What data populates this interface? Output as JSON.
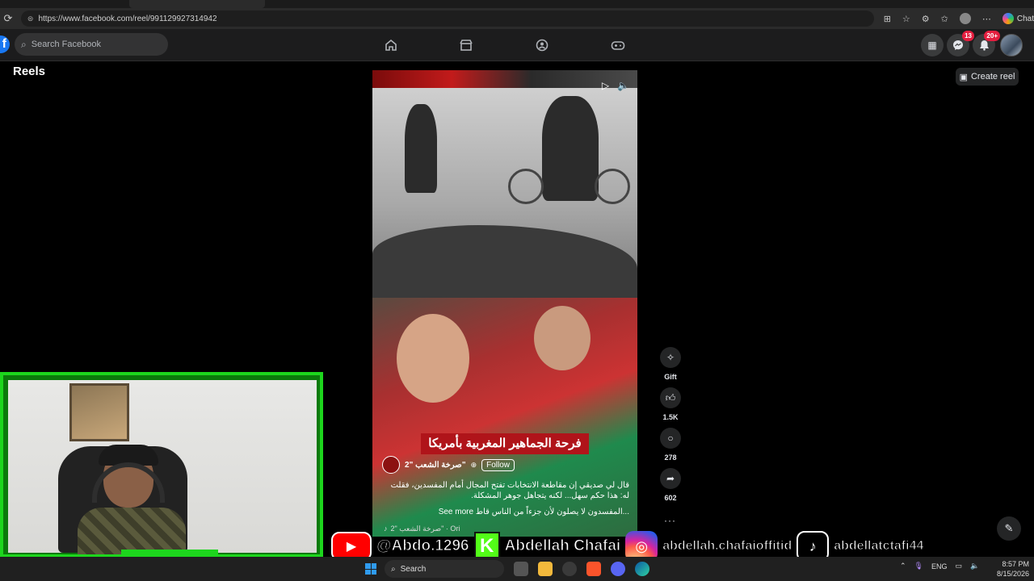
{
  "browser": {
    "url": "https://www.facebook.com/reel/991129927314942",
    "chat_label": "Chat"
  },
  "header": {
    "search_placeholder": "Search Facebook",
    "messenger_badge": "13",
    "notifications_badge": "20+"
  },
  "page": {
    "title": "Reels",
    "create_reel_label": "Create reel"
  },
  "reel": {
    "headline": "فرحة الجماهير المغربية بأمريكا",
    "author_name": "صرخة الشعب \"2\"",
    "follow_label": "Follow",
    "caption_line1": "قال لي صديقي إن مقاطعة الانتخابات تفتح المجال أمام المفسدين، فقلت له: هذا حكم سهل... لكنه يتجاهل جوهر المشكلة.",
    "caption_line2": "المفسدون لا يصلون لأن جزءاً من الناس قاط...",
    "see_more_label": "See more",
    "audio_label": "صرخة الشعب \"2\" · Ori"
  },
  "actions": {
    "gift_label": "Gift",
    "likes": "1.5K",
    "comments": "278",
    "shares": "602"
  },
  "banner": {
    "youtube_handle": "@Abdo.1296",
    "kick_handle": "Abdellah Chafai",
    "instagram_handle": "abdellah.chafaioffitid",
    "tiktok_handle": "abdellatctafi44"
  },
  "taskbar": {
    "search_label": "Search",
    "language": "ENG",
    "time": "8:57 PM",
    "date": "8/15/2026"
  },
  "colors": {
    "facebook_blue": "#1877f2",
    "badge_red": "#e41e3f",
    "webcam_green": "#1dd61d"
  }
}
